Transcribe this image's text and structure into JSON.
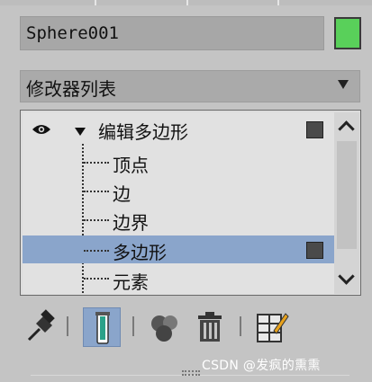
{
  "object_name": "Sphere001",
  "object_color": "#59d05a",
  "modifier_list": {
    "label": "修改器列表"
  },
  "stack": {
    "modifier": "编辑多边形",
    "subobjects": [
      "顶点",
      "边",
      "边界",
      "多边形",
      "元素"
    ],
    "selected": "多边形"
  },
  "toolbar": {
    "icons": [
      "pin-stack-icon",
      "show-end-result-icon",
      "make-unique-icon",
      "remove-modifier-icon",
      "configure-modifier-sets-icon"
    ],
    "active": "show-end-result-icon"
  },
  "watermark": "CSDN @发疯的熏熏"
}
